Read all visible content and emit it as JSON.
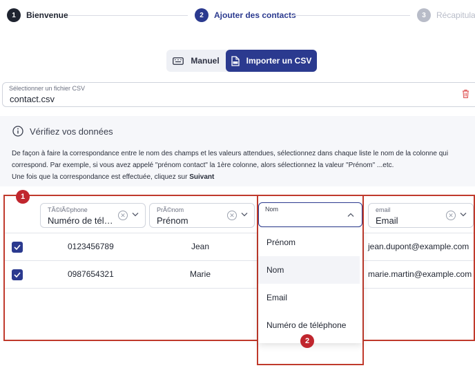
{
  "stepper": {
    "steps": [
      {
        "num": "1",
        "label": "Bienvenue"
      },
      {
        "num": "2",
        "label": "Ajouter des contacts"
      },
      {
        "num": "3",
        "label": "Récapitulatif"
      }
    ]
  },
  "mode": {
    "manual": "Manuel",
    "csv": "Importer un CSV"
  },
  "file": {
    "label": "Sélectionner un fichier CSV",
    "value": "contact.csv"
  },
  "info": {
    "title": "Vérifiez vos données",
    "line1": "De façon à faire la correspondance entre le nom des champs et les valeurs attendues, sélectionnez dans chaque liste le nom de la colonne qui correspond. Par exemple, si vous avez appelé \"prénom contact\" la 1ère colonne, alors sélectionnez la valeur \"Prénom\" ...etc.",
    "line2": "Une fois que la correspondance est effectuée, cliquez sur",
    "line2_bold": "Suivant"
  },
  "columns": [
    {
      "label": "TÃ©lÃ©phone",
      "value": "Numéro de tél…"
    },
    {
      "label": "PrÃ©nom",
      "value": "Prénom"
    },
    {
      "label": "Nom",
      "value": ""
    },
    {
      "label": "email",
      "value": "Email"
    }
  ],
  "rows": [
    {
      "phone": "0123456789",
      "first": "Jean",
      "email": "jean.dupont@example.com"
    },
    {
      "phone": "0987654321",
      "first": "Marie",
      "email": "marie.martin@example.com"
    }
  ],
  "dropdown": {
    "options": [
      "Prénom",
      "Nom",
      "Email",
      "Numéro de téléphone"
    ],
    "highlighted": "Nom"
  },
  "badges": [
    "1",
    "2"
  ],
  "colors": {
    "primary": "#2b3a8f",
    "annotation": "#c0392b",
    "inactive_step": "#b8bcc8",
    "delete": "#e05a5a"
  }
}
